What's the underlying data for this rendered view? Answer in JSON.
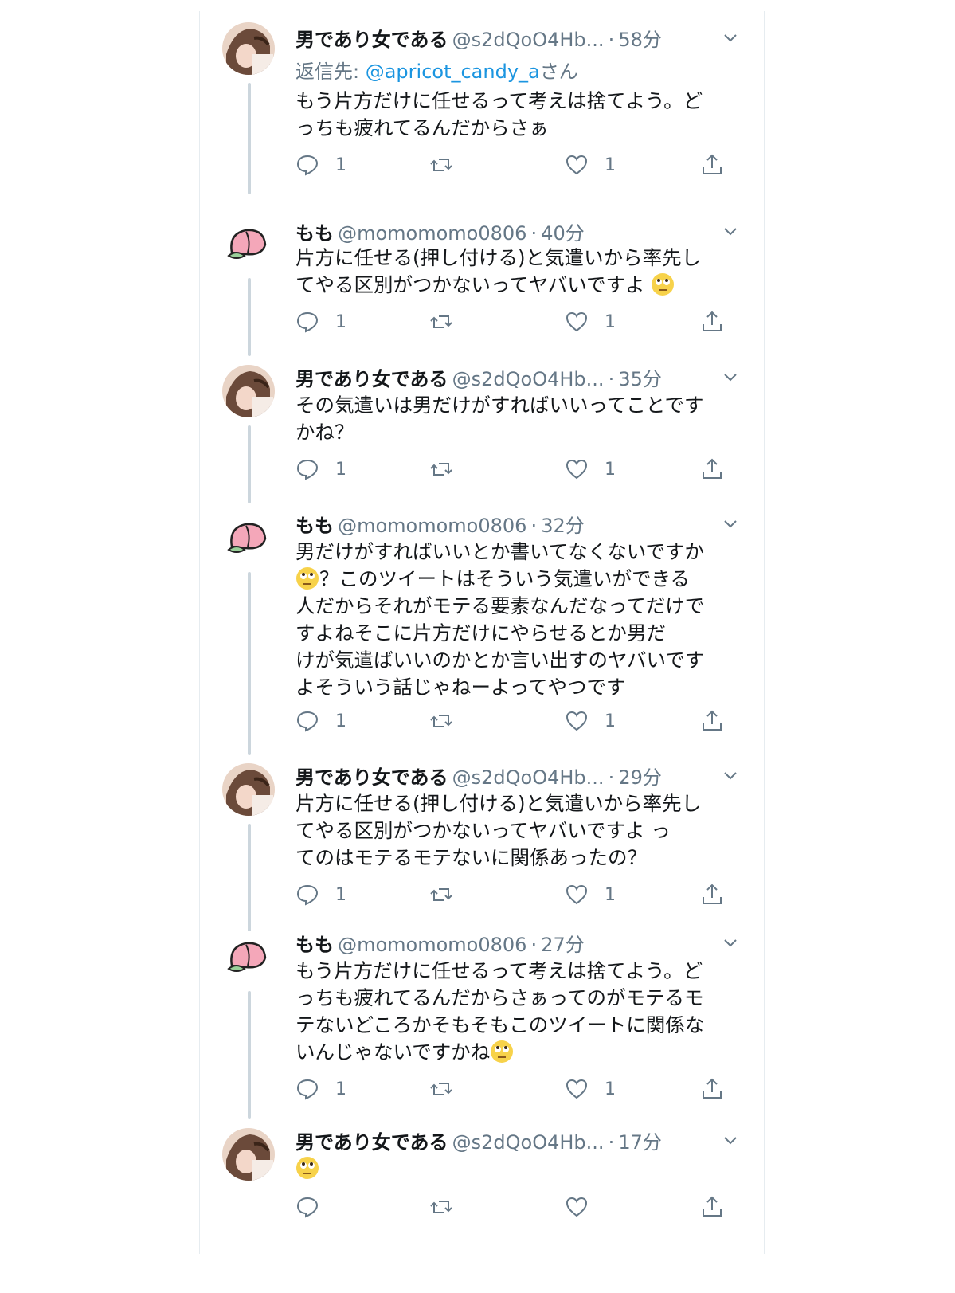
{
  "tweets": [
    {
      "name": "男であり女である",
      "handle": "@s2dQoO4Hb...",
      "time": "58分",
      "reply_label": "返信先: ",
      "reply_mention": "@apricot_candy_a",
      "reply_suffix": "さん",
      "lines": [
        "もう片方だけに任せるって考えは捨てよう。ど",
        "っちも疲れてるんだからさぁ"
      ],
      "reply_count": "1",
      "like_count": "1"
    },
    {
      "name": "もも",
      "handle": "@momomomo0806",
      "time": "40分",
      "lines": [
        "片方に任せる(押し付ける)と気遣いから率先し",
        "てやる区別がつかないってヤバいですよ "
      ],
      "reply_count": "1",
      "like_count": "1"
    },
    {
      "name": "男であり女である",
      "handle": "@s2dQoO4Hb...",
      "time": "35分",
      "lines": [
        "その気遣いは男だけがすればいいってことです",
        "かね？"
      ],
      "reply_count": "1",
      "like_count": "1"
    },
    {
      "name": "もも",
      "handle": "@momomomo0806",
      "time": "32分",
      "lines": [
        "男だけがすればいいとか書いてなくないですか",
        "？このツイートはそういう気遣いができる",
        "人だからそれがモテる要素なんだなってだけで",
        "すよねそこに片方だけにやらせるとか男だ",
        "けが気遣ばいいのかとか言い出すのヤバいです",
        "よそういう話じゃねーよってやつです"
      ],
      "reply_count": "1",
      "like_count": "1"
    },
    {
      "name": "男であり女である",
      "handle": "@s2dQoO4Hb...",
      "time": "29分",
      "lines": [
        "片方に任せる(押し付ける)と気遣いから率先し",
        "てやる区別がつかないってヤバいですよ っ",
        "てのはモテるモテないに関係あったの？"
      ],
      "reply_count": "1",
      "like_count": "1"
    },
    {
      "name": "もも",
      "handle": "@momomomo0806",
      "time": "27分",
      "lines": [
        "もう片方だけに任せるって考えは捨てよう。ど",
        "っちも疲れてるんだからさぁってのがモテるモ",
        "テないどころかそもそもこのツイートに関係な",
        "いんじゃないですかね"
      ],
      "reply_count": "1",
      "like_count": "1"
    },
    {
      "name": "男であり女である",
      "handle": "@s2dQoO4Hb...",
      "time": "17分",
      "lines": [
        ""
      ],
      "reply_count": "",
      "like_count": ""
    }
  ],
  "icons": {
    "reply": "reply-bubble-icon",
    "retweet": "retweet-icon",
    "like": "heart-icon",
    "share": "share-icon",
    "caret": "chevron-down-icon",
    "emoji": "rolling-eyes-emoji"
  },
  "colors": {
    "mention": "#1b95e0",
    "secondary": "#657786",
    "text": "#14171a"
  }
}
